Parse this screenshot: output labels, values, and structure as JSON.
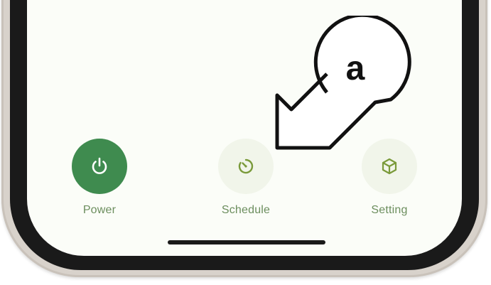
{
  "callout": {
    "letter": "a"
  },
  "nav": {
    "items": [
      {
        "id": "power",
        "label": "Power",
        "icon": "power-icon",
        "active": true
      },
      {
        "id": "schedule",
        "label": "Schedule",
        "icon": "timer-icon",
        "active": false
      },
      {
        "id": "setting",
        "label": "Setting",
        "icon": "cube-icon",
        "active": false
      }
    ]
  },
  "colors": {
    "accent": "#3f8b4f",
    "label": "#6c8e5e",
    "icon_muted": "#7a9a3a",
    "icon_bg": "#f1f5ea",
    "screen_bg": "#fbfdf8",
    "bezel": "#1a1a1a"
  }
}
